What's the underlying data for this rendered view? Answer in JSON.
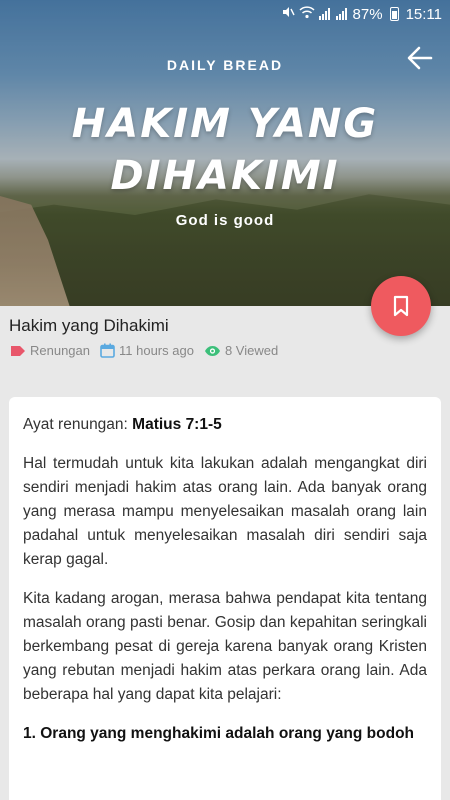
{
  "status_bar": {
    "battery": "87%",
    "time": "15:11"
  },
  "hero": {
    "eyebrow": "DAILY BREAD",
    "title_line1": "HAKIM YANG",
    "title_line2": "DIHAKIMI",
    "tagline": "God is good"
  },
  "post": {
    "title": "Hakim yang Dihakimi",
    "category": "Renungan",
    "time_ago": "11 hours ago",
    "views": "8 Viewed"
  },
  "article": {
    "verse_label": "Ayat renungan: ",
    "verse_ref": "Matius 7:1-5",
    "paragraph1": "Hal termudah untuk kita lakukan adalah mengangkat diri sendiri menjadi hakim atas orang lain. Ada banyak orang yang merasa mampu menyelesaikan masalah orang lain padahal untuk menyelesaikan masalah diri sendiri saja kerap gagal.",
    "paragraph2": "Kita kadang arogan, merasa bahwa pendapat kita tentang masalah orang pasti benar. Gosip dan kepahitan seringkali berkembang pesat di gereja karena banyak orang Kristen yang rebutan menjadi hakim atas perkara orang lain. Ada beberapa hal yang dapat kita pelajari:",
    "heading1": "1. Orang yang menghakimi adalah orang yang bodoh"
  },
  "icons": {
    "back": "arrow-left-icon",
    "bookmark": "bookmark-icon",
    "category": "tag-icon",
    "time": "calendar-icon",
    "views": "eye-icon"
  },
  "colors": {
    "fab": "#ef5a5f",
    "tag_icon": "#e8566a",
    "calendar_icon": "#5aa9e0",
    "eye_icon": "#3cbf7a"
  }
}
